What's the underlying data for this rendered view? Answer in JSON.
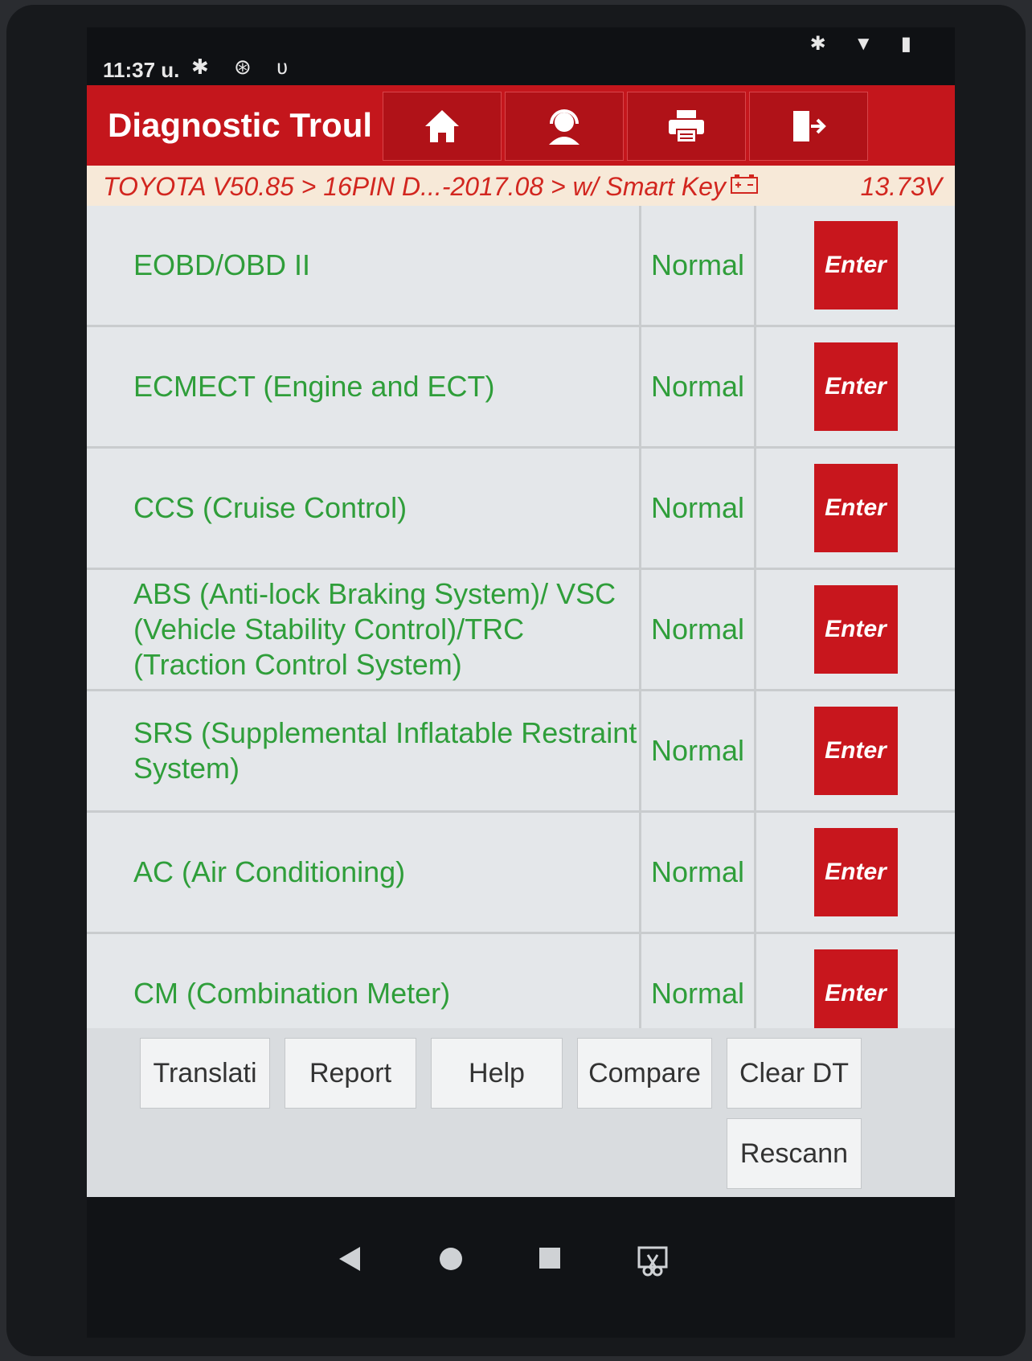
{
  "status_bar": {
    "time": "11:37 u.",
    "left_icons": [
      "gear-icon",
      "bluetooth-circle-icon",
      "stethoscope-icon"
    ],
    "right_icons": [
      "bluetooth-icon",
      "wifi-icon",
      "battery-icon"
    ]
  },
  "header": {
    "title": "Diagnostic Troul",
    "nav_icons": [
      "home-icon",
      "support-agent-icon",
      "print-icon",
      "exit-icon"
    ]
  },
  "breadcrumb": {
    "path": "TOYOTA V50.85 > 16PIN D...-2017.08 > w/ Smart Key",
    "battery_icon": "car-battery-icon",
    "voltage": "13.73V"
  },
  "systems": [
    {
      "name": "EOBD/OBD II",
      "status": "Normal",
      "action": "Enter"
    },
    {
      "name": "ECMECT (Engine and ECT)",
      "status": "Normal",
      "action": "Enter"
    },
    {
      "name": "CCS (Cruise Control)",
      "status": "Normal",
      "action": "Enter"
    },
    {
      "name": "ABS (Anti-lock Braking System)/ VSC (Vehicle Stability Control)/TRC (Traction Control System)",
      "status": "Normal",
      "action": "Enter"
    },
    {
      "name": "SRS (Supplemental Inflatable Restraint System)",
      "status": "Normal",
      "action": "Enter"
    },
    {
      "name": "AC (Air Conditioning)",
      "status": "Normal",
      "action": "Enter"
    },
    {
      "name": "CM (Combination Meter)",
      "status": "Normal",
      "action": "Enter"
    }
  ],
  "toolbar": {
    "translate": "Translati",
    "report": "Report",
    "help": "Help",
    "compare": "Compare",
    "clear_dtc": "Clear DT",
    "rescan": "Rescann"
  },
  "android_nav": [
    "back-icon",
    "home-circle-icon",
    "recents-icon",
    "screenshot-icon"
  ],
  "colors": {
    "brand_red": "#c4161c",
    "status_green": "#2f9e3a",
    "breadcrumb_bg": "#f7e9d8"
  }
}
